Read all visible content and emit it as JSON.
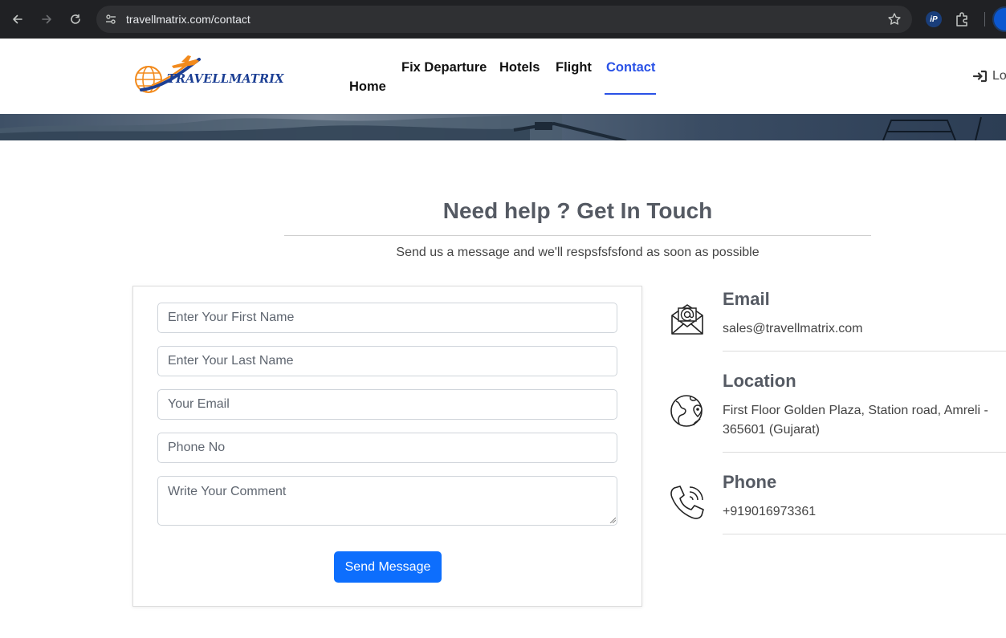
{
  "browser": {
    "url": "travellmatrix.com/contact",
    "extension_label": "iP"
  },
  "site": {
    "logo_text": "TRAVELLMATRIX",
    "accent_color": "#2a52e6",
    "button_color": "#0d6efd",
    "nav": {
      "home": "Home",
      "fix_departure": "Fix Departure",
      "hotels": "Hotels",
      "flight": "Flight",
      "contact": "Contact",
      "active": "Contact"
    },
    "login_label": "Lo"
  },
  "contact": {
    "heading": "Need help ? Get In Touch",
    "subheading": "Send us a message and we'll respsfsfsfond as soon as possible",
    "form": {
      "first_name_placeholder": "Enter Your First Name",
      "last_name_placeholder": "Enter Your Last Name",
      "email_placeholder": "Your Email",
      "phone_placeholder": "Phone No",
      "comment_placeholder": "Write Your Comment",
      "submit_label": "Send Message"
    },
    "info": {
      "email_title": "Email",
      "email_value": "sales@travellmatrix.com",
      "location_title": "Location",
      "location_value": "First Floor Golden Plaza, Station road, Amreli - 365601 (Gujarat)",
      "phone_title": "Phone",
      "phone_value": "+919016973361"
    }
  }
}
